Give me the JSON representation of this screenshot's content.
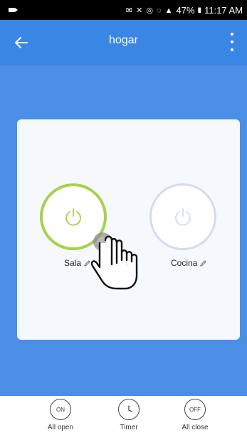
{
  "status_bar": {
    "battery": "47%",
    "time": "11:17 AM"
  },
  "app_bar": {
    "title": "hogar"
  },
  "devices": [
    {
      "name": "Sala",
      "state": "on",
      "ring_color": "#a8d04c"
    },
    {
      "name": "Cocina",
      "state": "off",
      "ring_color": "#d4dcea"
    }
  ],
  "bottom_bar": {
    "all_open": {
      "icon_text": "ON",
      "label": "All open"
    },
    "timer": {
      "label": "Timer"
    },
    "all_close": {
      "icon_text": "OFF",
      "label": "All close"
    }
  },
  "colors": {
    "accent_blue": "#3a86e4",
    "content_blue": "#4a8ee6",
    "power_on_green": "#a8d04c",
    "power_off_gray": "#d4dcea"
  }
}
